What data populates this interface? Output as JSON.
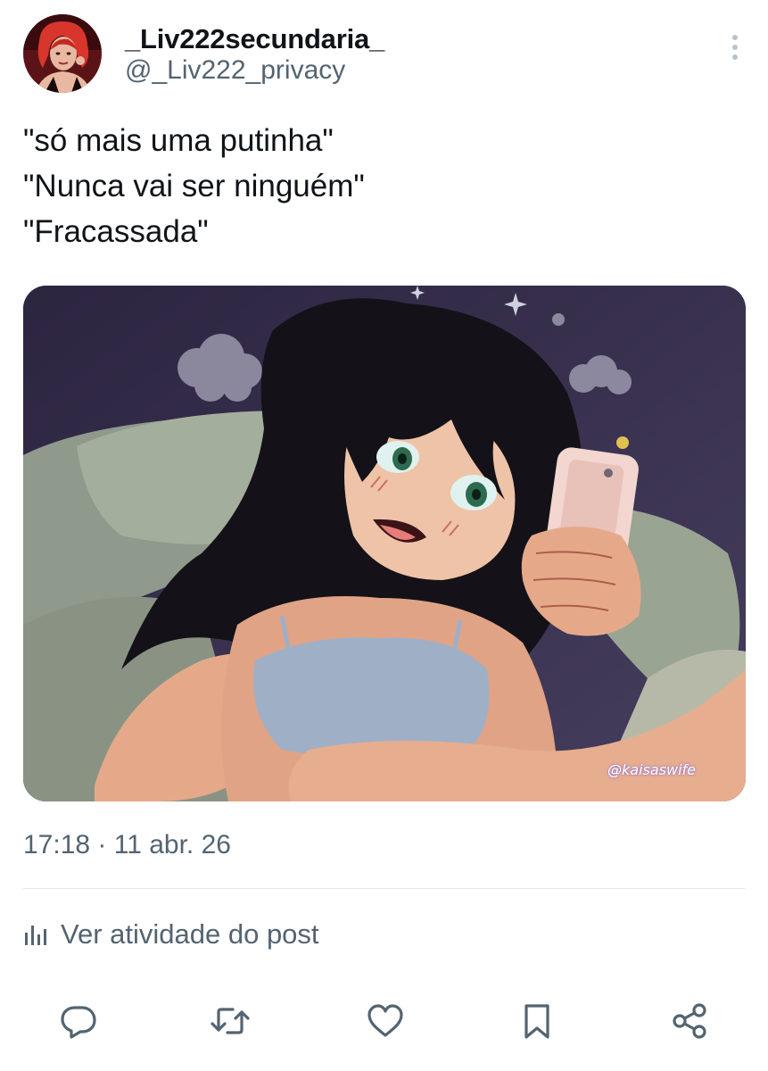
{
  "author": {
    "display_name": "_Liv222secundaria_",
    "handle": "@_Liv222_privacy",
    "avatar_icon": "profile-photo"
  },
  "header": {
    "more_icon": "more-vertical-icon"
  },
  "tweet": {
    "lines": [
      "\"só mais uma putinha\"",
      "\"Nunca vai ser ninguém\"",
      "\"Fracassada\""
    ],
    "image_watermark": "@kaisaswife",
    "timestamp": "17:18 · 11 abr. 26"
  },
  "activity": {
    "icon": "analytics-bars-icon",
    "label": "Ver atividade do post"
  },
  "actions": [
    {
      "name": "reply",
      "icon": "reply-icon"
    },
    {
      "name": "repost",
      "icon": "repost-icon"
    },
    {
      "name": "like",
      "icon": "heart-icon"
    },
    {
      "name": "bookmark",
      "icon": "bookmark-icon"
    },
    {
      "name": "share",
      "icon": "share-icon"
    }
  ],
  "colors": {
    "primary_text": "#0f1419",
    "secondary_text": "#536471",
    "divider": "#e1e6ea"
  }
}
